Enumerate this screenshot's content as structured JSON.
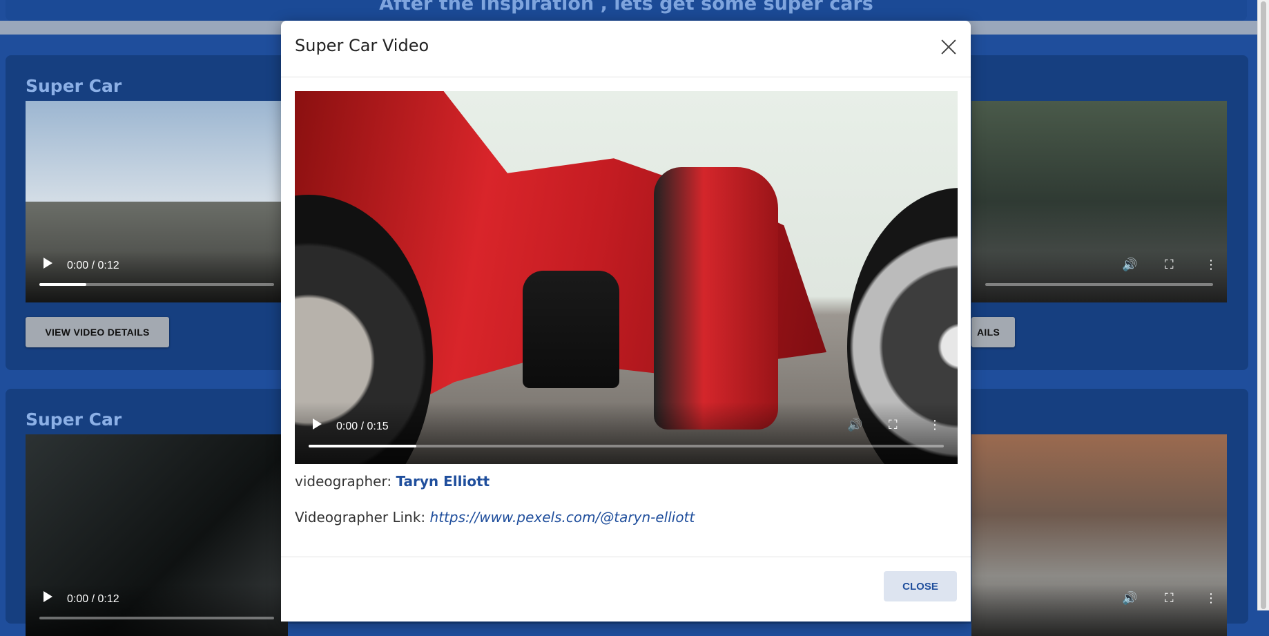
{
  "page": {
    "banner_text": "After the inspiration , lets get some super cars"
  },
  "cards": [
    {
      "title": "Super Car",
      "videos": [
        {
          "time": "0:00 / 0:12",
          "progress": 0.2
        },
        {
          "time": "",
          "progress": 0.0
        }
      ],
      "buttons": [
        "VIEW VIDEO DETAILS",
        "AILS"
      ]
    },
    {
      "title": "Super Car",
      "videos": [
        {
          "time": "0:00 / 0:12",
          "progress": 0.0
        },
        {
          "time": "",
          "progress": 0.0
        }
      ]
    }
  ],
  "modal": {
    "title": "Super Car Video",
    "video": {
      "time": "0:00 / 0:15",
      "progress": 0.17
    },
    "videographer_label": "videographer:",
    "videographer_name": "Taryn Elliott",
    "link_label": "Videographer Link:",
    "link_url": "https://www.pexels.com/@taryn-elliott",
    "close_label": "CLOSE"
  },
  "icons": {
    "play": "play-icon",
    "volume": "volume-icon",
    "fullscreen": "fullscreen-icon",
    "more": "more-options-icon",
    "close": "close-icon"
  },
  "colors": {
    "page_background": "#1f4e9c",
    "card_background": "#163f80",
    "accent": "#1f4e9c",
    "details_button": "#a3a9b1",
    "close_button": "#dde4f0"
  }
}
